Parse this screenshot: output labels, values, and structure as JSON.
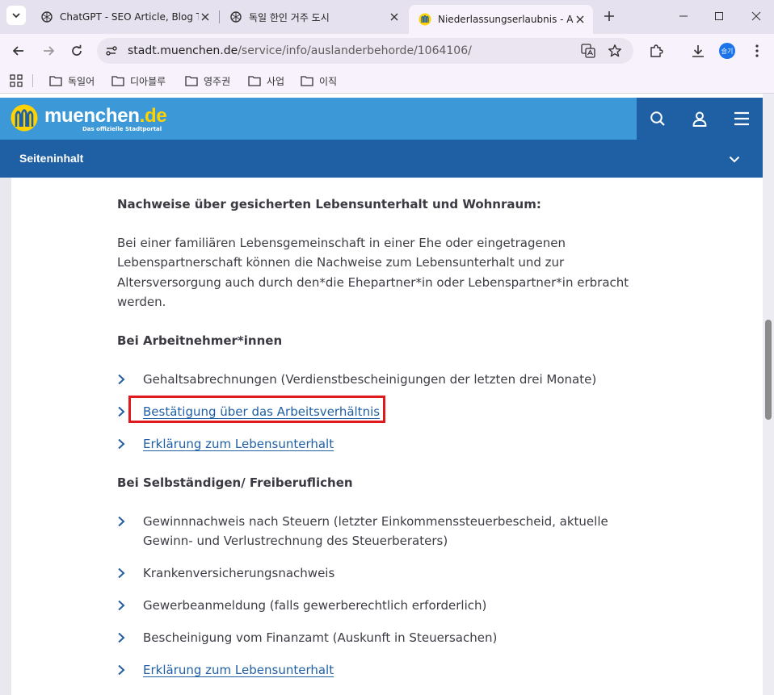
{
  "browser": {
    "tabs": [
      {
        "title": "ChatGPT - SEO Article, Blog T",
        "icon": "chatgpt-icon"
      },
      {
        "title": "독일 한인 거주 도시",
        "icon": "chatgpt-icon"
      },
      {
        "title": "Niederlassungserlaubnis - Au",
        "icon": "muenchen-icon",
        "active": true
      }
    ],
    "url_host": "stadt.muenchen.de",
    "url_path": "/service/info/auslanderbehorde/1064106/",
    "profile_label": "슬기",
    "bookmarks": [
      {
        "label": "독일어"
      },
      {
        "label": "디아블루"
      },
      {
        "label": "영주권"
      },
      {
        "label": "사업"
      },
      {
        "label": "이직"
      }
    ]
  },
  "site": {
    "logo_name": "muenchen",
    "logo_tld": ".de",
    "logo_sub": "Das offizielle Stadtportal",
    "brand_color": "#3d98d7",
    "dark_color": "#1f5fa3",
    "section_toggle": "Seiteninhalt"
  },
  "content": {
    "heading_main": "Nachweise über gesicherten Lebensunterhalt und Wohnraum:",
    "intro_lines": [
      "Bei einer familiären Lebensgemeinschaft in einer Ehe oder eingetragenen",
      "Lebenspartnerschaft können die Nachweise zum Lebensunterhalt und zur",
      "Altersversorgung auch durch den*die Ehepartner*in oder Lebenspartner*in erbracht",
      "werden."
    ],
    "heading_employees": "Bei Arbeitnehmer*innen",
    "employees": [
      {
        "text": "Gehaltsabrechnungen (Verdienstbescheinigungen der letzten drei Monate)",
        "link": false
      },
      {
        "text": "Bestätigung über das Arbeitsverhältnis",
        "link": true,
        "highlighted": true
      },
      {
        "text": "Erklärung zum Lebensunterhalt",
        "link": true
      }
    ],
    "heading_selfemployed": "Bei Selbständigen/ Freiberuflichen",
    "selfemployed": [
      {
        "lines": [
          "Gewinnnachweis nach Steuern (letzter Einkommenssteuerbescheid, aktuelle",
          "Gewinn- und Verlustrechnung des Steuerberaters)"
        ],
        "link": false
      },
      {
        "lines": [
          "Krankenversicherungsnachweis"
        ],
        "link": false
      },
      {
        "lines": [
          "Gewerbeanmeldung (falls gewerberechtlich erforderlich)"
        ],
        "link": false
      },
      {
        "lines": [
          "Bescheinigung vom Finanzamt (Auskunft in Steuersachen)"
        ],
        "link": false
      },
      {
        "lines": [
          "Erklärung zum Lebensunterhalt"
        ],
        "link": true
      }
    ],
    "highlight_color": "#e0191e"
  }
}
